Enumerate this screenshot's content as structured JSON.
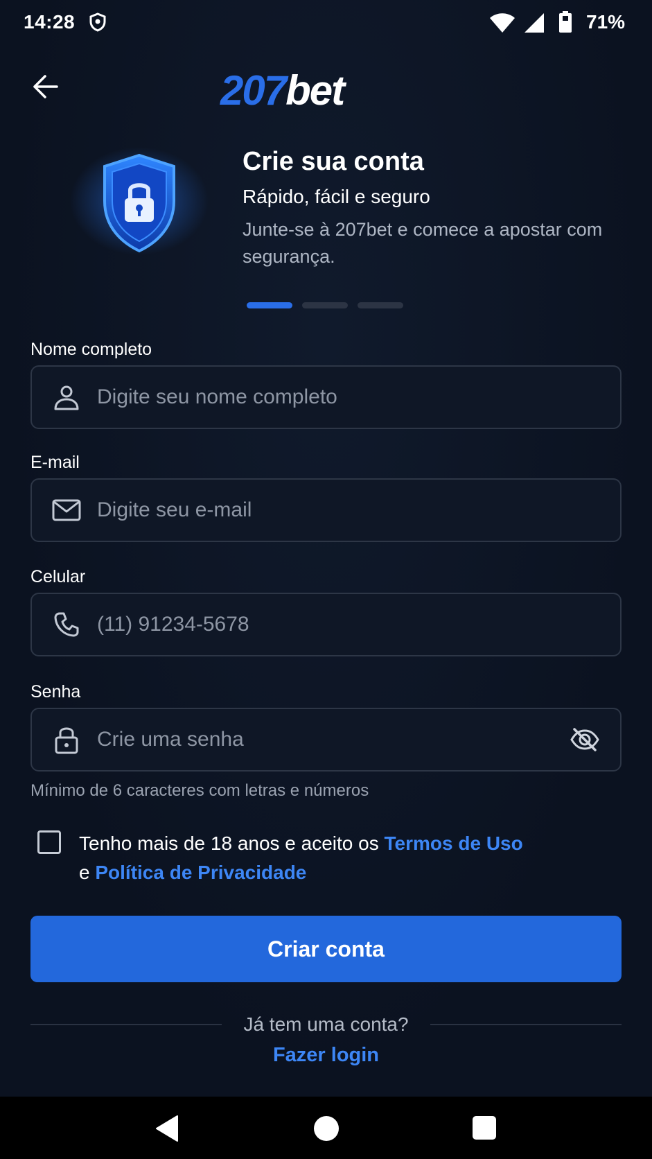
{
  "status_bar": {
    "time": "14:28",
    "battery_percent": "71%",
    "icons": [
      "shield-icon",
      "wifi-icon",
      "signal-icon",
      "battery-icon"
    ]
  },
  "header": {
    "logo_number": "207",
    "logo_word": "bet",
    "back_icon": "arrow-left-icon"
  },
  "hero": {
    "title": "Crie sua conta",
    "subtitle": "Rápido, fácil e seguro",
    "description": "Junte-se à 207bet e comece a apostar com segurança.",
    "icon": "shield-lock-icon",
    "pager_active_index": 0,
    "pager_count": 3
  },
  "form": {
    "name": {
      "label": "Nome completo",
      "placeholder": "Digite seu nome completo",
      "value": "",
      "icon": "user-icon"
    },
    "email": {
      "label": "E-mail",
      "placeholder": "Digite seu e-mail",
      "value": "",
      "icon": "mail-icon"
    },
    "phone": {
      "label": "Celular",
      "placeholder": "(11) 91234-5678",
      "value": "",
      "icon": "phone-icon"
    },
    "password": {
      "label": "Senha",
      "placeholder": "Crie uma senha",
      "value": "",
      "icon": "lock-icon",
      "toggle_icon": "eye-off-icon"
    },
    "password_hint": "Mínimo de 6 caracteres com letras e números",
    "terms": {
      "prefix": "Tenho mais de 18 anos e aceito os ",
      "terms_link": "Termos de Uso",
      "connector": "e ",
      "privacy_link": "Política de Privacidade",
      "checked": false
    },
    "submit_label": "Criar conta"
  },
  "footer": {
    "have_account": "Já tem uma conta?",
    "login_link": "Fazer login"
  },
  "colors": {
    "background": "#0b1220",
    "accent": "#2368dc",
    "link": "#3d86f5",
    "field_border": "#2d3646"
  }
}
